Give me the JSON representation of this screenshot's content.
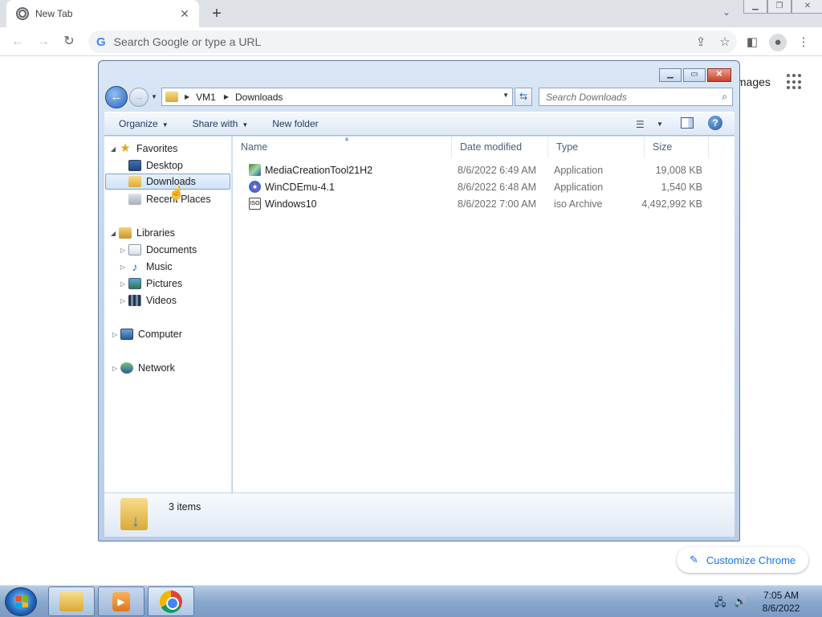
{
  "browser": {
    "tab_title": "New Tab",
    "tab_close": "✕",
    "new_tab": "+",
    "tab_search": "⌄",
    "omnibox_placeholder": "Search Google or type a URL",
    "google_g": "G",
    "ntp_images_link": "Images",
    "customize_label": "Customize Chrome"
  },
  "explorer": {
    "breadcrumb": [
      "VM1",
      "Downloads"
    ],
    "search_placeholder": "Search Downloads",
    "commands": {
      "organize": "Organize",
      "share_with": "Share with",
      "new_folder": "New folder"
    },
    "nav": {
      "favorites": "Favorites",
      "desktop": "Desktop",
      "downloads": "Downloads",
      "recent_places": "Recent Places",
      "libraries": "Libraries",
      "documents": "Documents",
      "music": "Music",
      "pictures": "Pictures",
      "videos": "Videos",
      "computer": "Computer",
      "network": "Network"
    },
    "columns": {
      "name": "Name",
      "date_modified": "Date modified",
      "type": "Type",
      "size": "Size"
    },
    "files": [
      {
        "name": "MediaCreationTool21H2",
        "date": "8/6/2022 6:49 AM",
        "type": "Application",
        "size": "19,008 KB",
        "icon": "app-icon"
      },
      {
        "name": "WinCDEmu-4.1",
        "date": "8/6/2022 6:48 AM",
        "type": "Application",
        "size": "1,540 KB",
        "icon": "app-icon"
      },
      {
        "name": "Windows10",
        "date": "8/6/2022 7:00 AM",
        "type": "iso Archive",
        "size": "4,492,992 KB",
        "icon": "iso-icon"
      }
    ],
    "iso_label": "ISO",
    "item_count": "3 items"
  },
  "taskbar": {
    "time": "7:05 AM",
    "date": "8/6/2022"
  }
}
